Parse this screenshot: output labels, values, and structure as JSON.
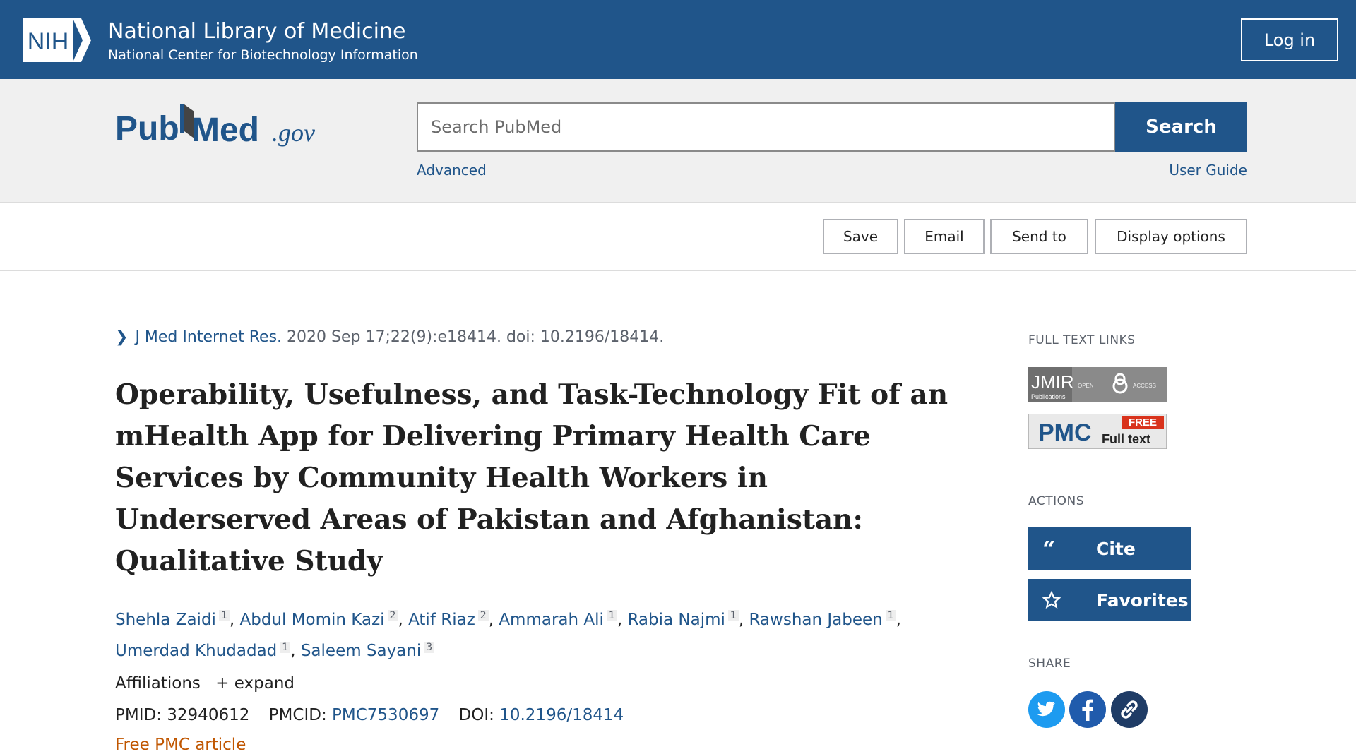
{
  "nih": {
    "logo_text": "NIH",
    "title": "National Library of Medicine",
    "subtitle": "National Center for Biotechnology Information",
    "login_label": "Log in"
  },
  "search": {
    "logo_pub": "Pub",
    "logo_med": "Med",
    "logo_gov": ".gov",
    "placeholder": "Search PubMed",
    "button_label": "Search",
    "advanced_label": "Advanced",
    "user_guide_label": "User Guide"
  },
  "toolbar": {
    "save": "Save",
    "email": "Email",
    "send_to": "Send to",
    "display_options": "Display options"
  },
  "article": {
    "journal": "J Med Internet Res.",
    "citation_rest": "2020 Sep 17;22(9):e18414. doi: 10.2196/18414.",
    "title": "Operability, Usefulness, and Task-Technology Fit of an mHealth App for Delivering Primary Health Care Services by Community Health Workers in Underserved Areas of Pakistan and Afghanistan: Qualitative Study",
    "authors": [
      {
        "name": "Shehla Zaidi",
        "aff": "1"
      },
      {
        "name": "Abdul Momin Kazi",
        "aff": "2"
      },
      {
        "name": "Atif Riaz",
        "aff": "2"
      },
      {
        "name": "Ammarah Ali",
        "aff": "1"
      },
      {
        "name": "Rabia Najmi",
        "aff": "1"
      },
      {
        "name": "Rawshan Jabeen",
        "aff": "1"
      },
      {
        "name": "Umerdad Khudadad",
        "aff": "1"
      },
      {
        "name": "Saleem Sayani",
        "aff": "3"
      }
    ],
    "affiliations_label": "Affiliations",
    "expand_label": "expand",
    "pmid_label": "PMID:",
    "pmid": "32940612",
    "pmcid_label": "PMCID:",
    "pmcid": "PMC7530697",
    "doi_label": "DOI:",
    "doi": "10.2196/18414",
    "free_pmc": "Free PMC article"
  },
  "sidebar": {
    "full_text_heading": "FULL TEXT LINKS",
    "jmir_text": "JMIR",
    "jmir_sub": "Publications",
    "jmir_access": "OPEN ACCESS",
    "pmc_text": "PMC",
    "pmc_free": "FREE",
    "pmc_full": "Full text",
    "actions_heading": "ACTIONS",
    "cite_label": "Cite",
    "favorites_label": "Favorites",
    "share_heading": "SHARE"
  },
  "colors": {
    "brand_blue": "#20558a",
    "twitter": "#1d9bf0",
    "facebook": "#205bac",
    "link_share": "#20558a",
    "free_pmc": "#c05600"
  }
}
